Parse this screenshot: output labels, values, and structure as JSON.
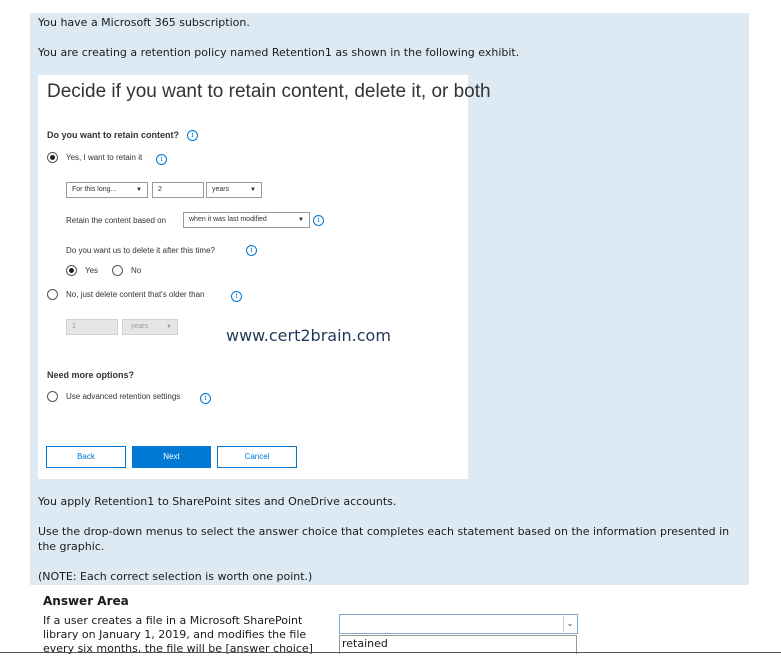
{
  "question": {
    "line1": "You have a Microsoft 365 subscription.",
    "line2": "You are creating a retention policy named Retention1 as shown in the following exhibit.",
    "line3": "You apply Retention1 to SharePoint sites and OneDrive accounts.",
    "line4": "Use the drop-down menus to select the answer choice that completes each statement based on the information presented in the graphic.",
    "line5": "(NOTE: Each correct selection is worth one point.)"
  },
  "exhibit": {
    "title": "Decide if you want to retain content, delete it, or both",
    "retain_question": "Do you want to retain content?",
    "option_yes": "Yes, I want to retain it",
    "period_select": "For this long...",
    "period_value": "2",
    "period_unit": "years",
    "based_on_label": "Retain the content based on",
    "based_on_value": "when it was last modified",
    "delete_question": "Do you want us to delete it after this time?",
    "delete_yes": "Yes",
    "delete_no": "No",
    "option_no": "No, just delete content that's older than",
    "older_value": "1",
    "older_unit": "years",
    "more_options": "Need more options?",
    "advanced": "Use advanced retention settings",
    "back": "Back",
    "next": "Next",
    "cancel": "Cancel",
    "info_glyph": "i",
    "caret_glyph": "▼"
  },
  "watermark": "www.cert2brain.com",
  "answer_area": {
    "title": "Answer Area",
    "statement": "If a user creates a file in a Microsoft SharePoint library on January 1, 2019, and modifies the file every six months, the file will be [answer choice]",
    "dropdown_value": "",
    "visible_option": "retained",
    "caret": "⌄"
  }
}
